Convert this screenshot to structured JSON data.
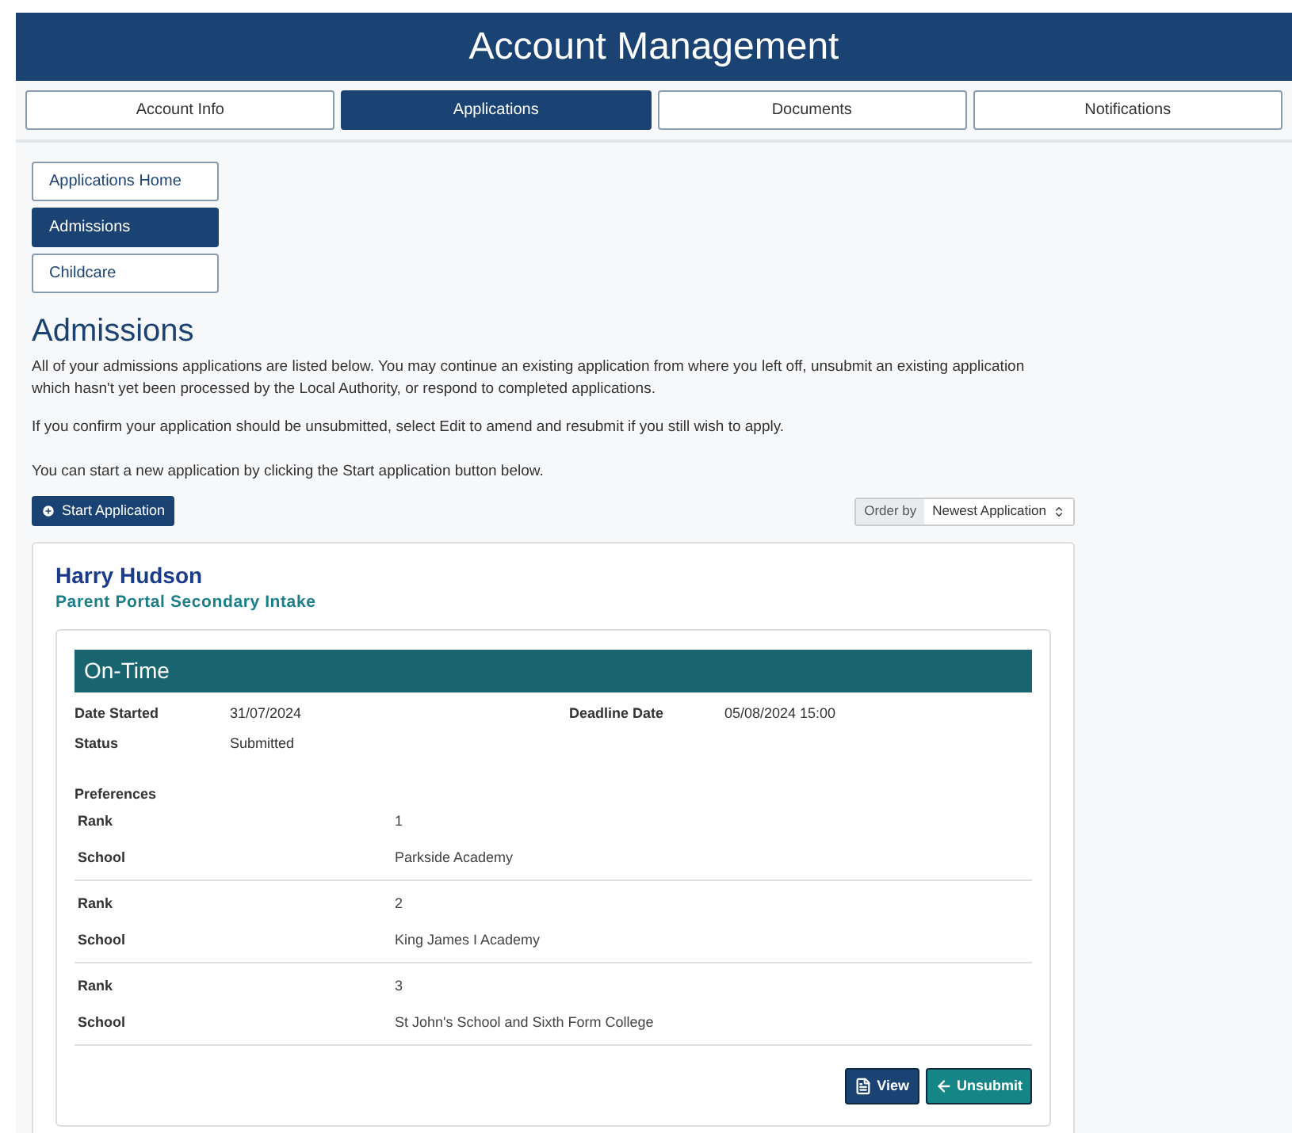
{
  "header": {
    "title": "Account Management"
  },
  "tabs": [
    {
      "label": "Account Info",
      "selected": false
    },
    {
      "label": "Applications",
      "selected": true
    },
    {
      "label": "Documents",
      "selected": false
    },
    {
      "label": "Notifications",
      "selected": false
    }
  ],
  "sidebar": {
    "items": [
      {
        "label": "Applications Home",
        "selected": false
      },
      {
        "label": "Admissions",
        "selected": true
      },
      {
        "label": "Childcare",
        "selected": false
      }
    ]
  },
  "page": {
    "title": "Admissions",
    "paragraphs": [
      "All of your admissions applications are listed below. You may continue an existing application from where you left off, unsubmit an existing application which hasn't yet been processed by the Local Authority, or respond to completed applications.",
      "If you confirm your application should be unsubmitted, select Edit to amend and resubmit if you still wish to apply.",
      "You can start a new application by clicking the Start application button below."
    ]
  },
  "start_button": "Start Application",
  "order_by": {
    "label": "Order by",
    "value": "Newest Application"
  },
  "application": {
    "name": "Harry Hudson",
    "intake": "Parent Portal Secondary Intake",
    "status_banner": "On-Time",
    "fields": [
      {
        "label": "Date Started",
        "value": "31/07/2024"
      },
      {
        "label": "Deadline Date",
        "value": "05/08/2024 15:00"
      },
      {
        "label": "Status",
        "value": "Submitted"
      }
    ],
    "preferences_title": "Preferences",
    "preferences": [
      {
        "rank_label": "Rank",
        "rank": "1",
        "school_label": "School",
        "school": "Parkside Academy"
      },
      {
        "rank_label": "Rank",
        "rank": "2",
        "school_label": "School",
        "school": "King James I Academy"
      },
      {
        "rank_label": "Rank",
        "rank": "3",
        "school_label": "School",
        "school": "St John's School and Sixth Form College"
      }
    ],
    "buttons": [
      {
        "kind": "view",
        "label": "View"
      },
      {
        "kind": "unsubmit",
        "label": "Unsubmit"
      }
    ]
  }
}
